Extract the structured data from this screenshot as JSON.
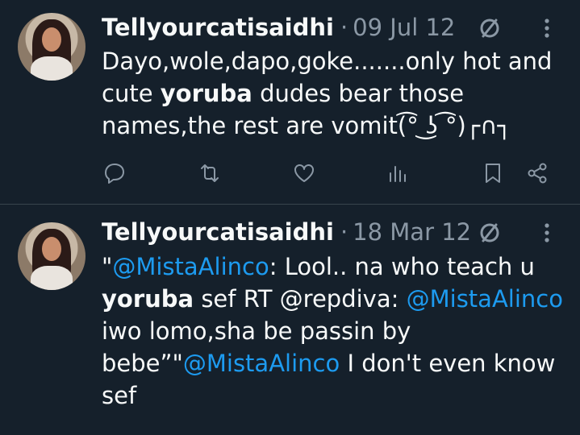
{
  "tweets": [
    {
      "author": "Tellyourcatisaidhi",
      "separator": "·",
      "date": "09 Jul 12",
      "text_parts": [
        {
          "t": "Dayo,wole,dapo,goke.......only hot and cute ",
          "style": "normal"
        },
        {
          "t": "yoruba",
          "style": "bold"
        },
        {
          "t": " dudes bear those names,the rest are vomit(͡° ͜ʖ ͡°)┌∩┐",
          "style": "normal"
        }
      ],
      "actions": [
        "reply-icon",
        "retweet-icon",
        "like-icon",
        "views-icon",
        "bookmark-icon",
        "share-icon"
      ]
    },
    {
      "author": "Tellyourcatisaidhi",
      "separator": "·",
      "date": "18 Mar 12",
      "text_parts": [
        {
          "t": "\"",
          "style": "normal"
        },
        {
          "t": "@MistaAlinco",
          "style": "mention"
        },
        {
          "t": ": Lool.. na who teach u ",
          "style": "normal"
        },
        {
          "t": "yoruba",
          "style": "bold"
        },
        {
          "t": " sef RT @repdiva: ",
          "style": "normal"
        },
        {
          "t": "@MistaAlinco",
          "style": "mention"
        },
        {
          "t": " iwo lomo,sha be passin by bebe”\"",
          "style": "normal"
        },
        {
          "t": "@MistaAlinco",
          "style": "mention"
        },
        {
          "t": " I don't even know sef",
          "style": "normal"
        }
      ]
    }
  ]
}
